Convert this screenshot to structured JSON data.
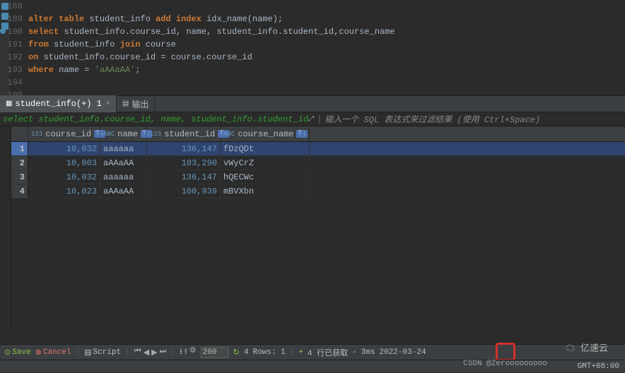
{
  "editor": {
    "lines": [
      {
        "no": "188",
        "bp": false,
        "tokens": [
          " "
        ]
      },
      {
        "no": "189",
        "bp": false,
        "tokens": []
      },
      {
        "no": "190",
        "bp": true,
        "tokens": []
      },
      {
        "no": "191",
        "bp": false,
        "tokens": []
      },
      {
        "no": "192",
        "bp": false,
        "tokens": []
      },
      {
        "no": "193",
        "bp": false,
        "tokens": []
      },
      {
        "no": "194",
        "bp": false,
        "tokens": []
      },
      {
        "no": "195",
        "bp": false,
        "tokens": []
      }
    ],
    "l189": {
      "k1": "alter",
      "k2": "table",
      "t1": " student_info ",
      "k3": "add",
      "t2": " ",
      "k4": "index",
      "t3": " idx_name(name);"
    },
    "l190": {
      "k1": "select",
      "t1": " student_info.course_id, name, student_info.student_id,course_name"
    },
    "l191": {
      "k1": "from",
      "t1": " student_info ",
      "k2": "join",
      "t2": " course"
    },
    "l192": {
      "k1": "on",
      "t1": " student_info.course_id = course.course_id"
    },
    "l193": {
      "k1": "where",
      "t1": " name = ",
      "s1": "'aAAaAA'",
      "t2": ";"
    }
  },
  "tabs": {
    "t1": "student_info(+) 1",
    "t2": "输出"
  },
  "filter": {
    "sql": "select student_info.course_id, name, student_info.student_id",
    "hint": "输入一个 SQL 表达式来过滤结果 (使用 Ctrl+Space)"
  },
  "cols": {
    "c1": {
      "type": "123",
      "name": "course_id"
    },
    "c2": {
      "type": "ABC",
      "name": "name"
    },
    "c3": {
      "type": "123",
      "name": "student_id"
    },
    "c4": {
      "type": "ABC",
      "name": "course_name"
    }
  },
  "rows": [
    {
      "n": "1",
      "c1": "10,032",
      "c2": "aaaaaa",
      "c3": "136,147",
      "c4": "fDzQDt",
      "sel": true
    },
    {
      "n": "2",
      "c1": "10,003",
      "c2": "aAAaAA",
      "c3": "103,290",
      "c4": "vWyCrZ",
      "sel": false
    },
    {
      "n": "3",
      "c1": "10,032",
      "c2": "aaaaaa",
      "c3": "136,147",
      "c4": "hQECWc",
      "sel": false
    },
    {
      "n": "4",
      "c1": "10,023",
      "c2": "aAAaAA",
      "c3": "100,939",
      "c4": "mBVXbn",
      "sel": false
    }
  ],
  "status": {
    "save": "Save",
    "cancel": "Cancel",
    "script": "Script",
    "pagesize": "200",
    "rows_arrow": "4",
    "rows_label": "Rows: 1",
    "fetch": "4 行已获取",
    "ms": "3ms",
    "date": "2022-03-24"
  },
  "gmt": "GMT+08:00",
  "wm1": "亿速云",
  "wm2": "CSDN @Zerooooooooo"
}
